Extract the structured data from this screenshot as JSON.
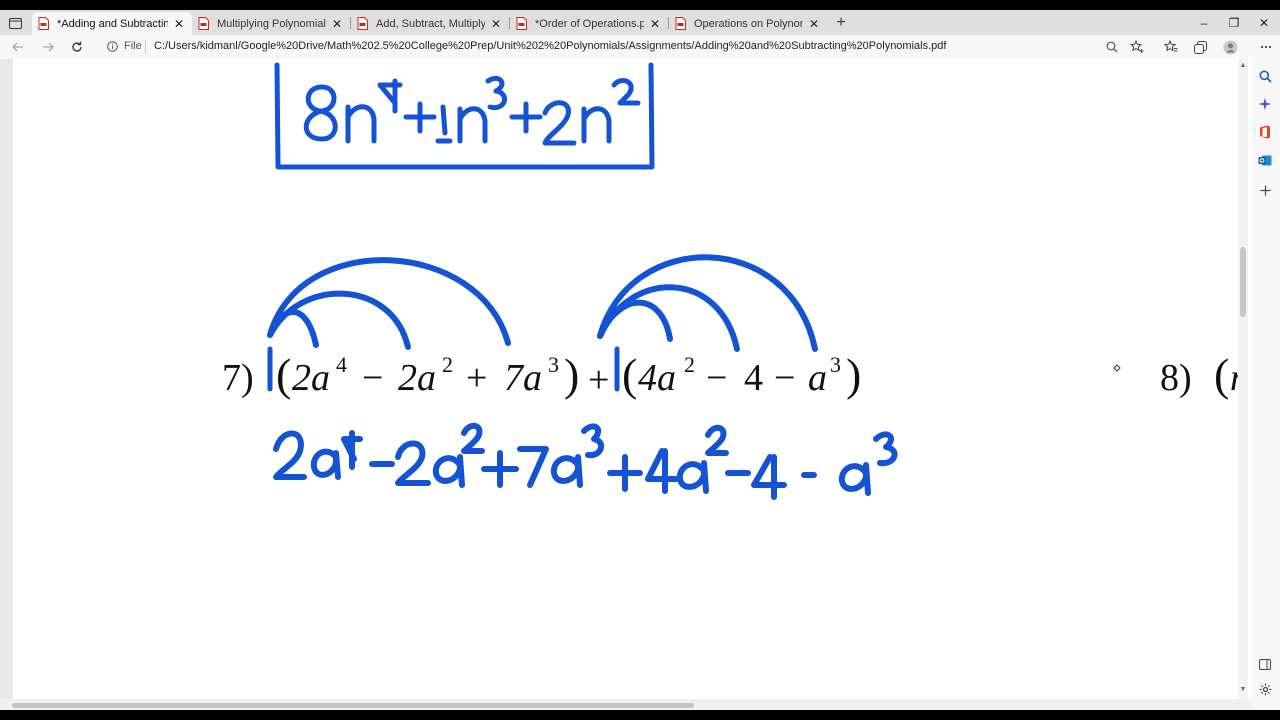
{
  "window": {
    "tabs": [
      {
        "title": "*Adding and Subtracting Polynomials.pdf",
        "active": true
      },
      {
        "title": "Multiplying Polynomials.pdf",
        "active": false
      },
      {
        "title": "Add, Subtract, Multiply Review.pdf",
        "active": false
      },
      {
        "title": "*Order of Operations.pdf",
        "active": false
      },
      {
        "title": "Operations on Polynomials Key.pdf",
        "active": false
      }
    ],
    "new_tab_label": "+",
    "controls": {
      "minimize": "–",
      "restore": "❐",
      "close": "✕"
    }
  },
  "address_bar": {
    "scheme_label": "File",
    "url": "C:/Users/kidmanl/Google%20Drive/Math%202.5%20College%20Prep/Unit%202%20Polynomials/Assignments/Adding%20and%20Subtracting%20Polynomials.pdf"
  },
  "icons": {
    "back": "arrow-left-icon",
    "forward": "arrow-right-icon",
    "refresh": "refresh-icon",
    "info": "info-icon",
    "zoom": "zoom-icon",
    "favorite": "star-add-icon",
    "favorites": "favorites-icon",
    "collections": "collections-icon",
    "profile": "profile-icon",
    "menu": "more-icon",
    "search": "search-icon",
    "copilot": "sparkle-icon",
    "office": "office-icon",
    "outlook": "outlook-icon",
    "add": "plus-icon",
    "sidebar_toggle": "sidebar-icon",
    "settings": "gear-icon"
  },
  "document": {
    "problem_7": {
      "number": "7)",
      "first_group": {
        "open": "(",
        "terms": [
          "2a",
          "4",
          "−",
          "2a",
          "2",
          "+",
          "7a",
          "3"
        ],
        "close": ")"
      },
      "plus": "+",
      "second_group": {
        "open": "(",
        "terms": [
          "4a",
          "2",
          "−",
          "4",
          "−",
          "a",
          "3"
        ],
        "close": ")"
      }
    },
    "problem_8": {
      "number": "8)",
      "open": "(",
      "fragment": "n"
    }
  },
  "colors": {
    "ink": "#1453d4",
    "tab_strip": "#dfdfdf",
    "toolbar": "#f7f7f7",
    "pdf_icon": "#c42b1c"
  }
}
